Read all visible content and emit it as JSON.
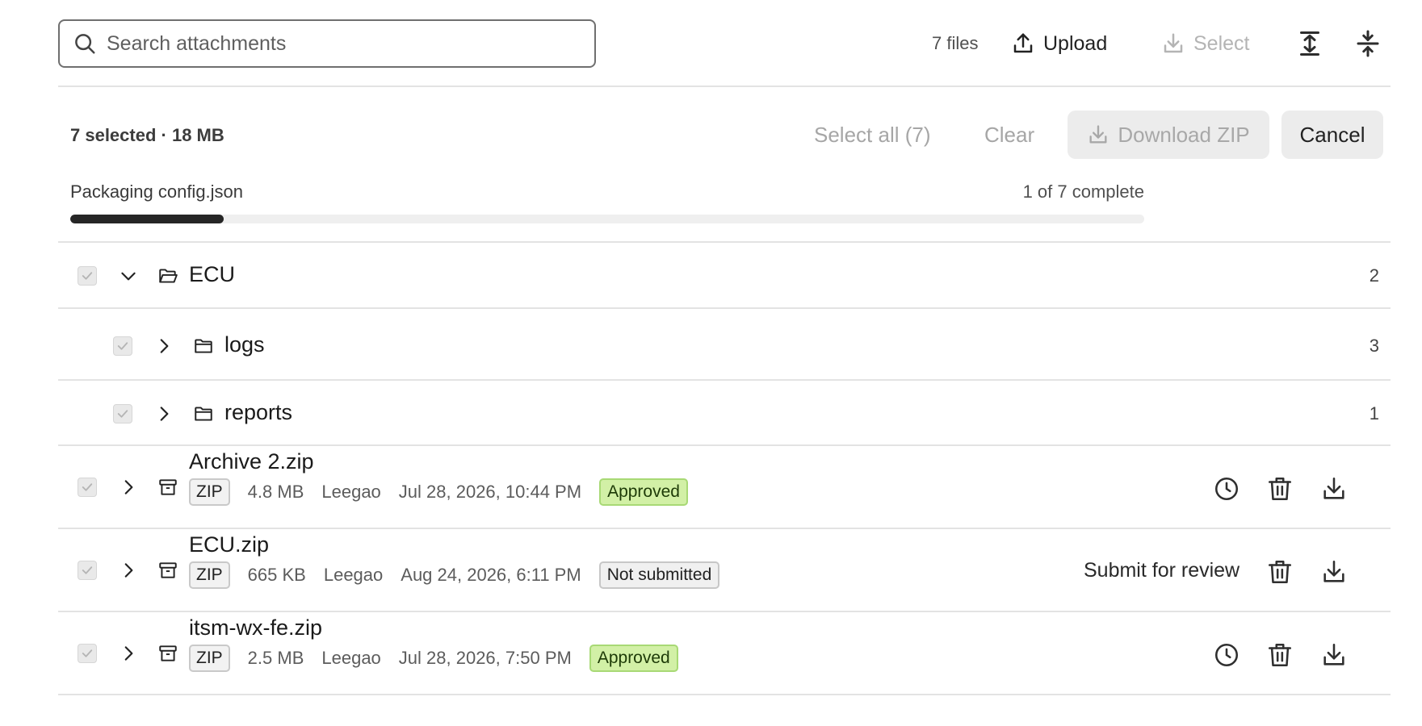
{
  "toolbar": {
    "search_placeholder": "Search attachments",
    "file_count": "7 files",
    "upload_label": "Upload",
    "select_label": "Select"
  },
  "selection": {
    "summary": "7 selected · 18 MB",
    "select_all_label": "Select all (7)",
    "clear_label": "Clear",
    "download_zip_label": "Download ZIP",
    "cancel_label": "Cancel"
  },
  "progress": {
    "label": "Packaging config.json",
    "count_text": "1 of 7 complete",
    "value": 0.143
  },
  "tree": {
    "root": {
      "name": "ECU",
      "count": "2"
    },
    "folders": [
      {
        "name": "logs",
        "count": "3"
      },
      {
        "name": "reports",
        "count": "1"
      }
    ],
    "files": [
      {
        "name": "Archive 2.zip",
        "type": "ZIP",
        "size": "4.8 MB",
        "owner": "Leegao",
        "date": "Jul 28, 2026, 10:44 PM",
        "status": "Approved"
      },
      {
        "name": "ECU.zip",
        "type": "ZIP",
        "size": "665 KB",
        "owner": "Leegao",
        "date": "Aug 24, 2026, 6:11 PM",
        "status": "Not submitted",
        "action_label": "Submit for review"
      },
      {
        "name": "itsm-wx-fe.zip",
        "type": "ZIP",
        "size": "2.5 MB",
        "owner": "Leegao",
        "date": "Jul 28, 2026, 7:50 PM",
        "status": "Approved"
      }
    ]
  },
  "icons": {
    "search": "search-icon",
    "upload": "upload-icon",
    "download": "download-icon",
    "expand_all": "expand-all-icon",
    "collapse_all": "collapse-all-icon",
    "folder_open": "folder-open-icon",
    "folder": "folder-icon",
    "archive": "archive-icon",
    "history": "clock-icon",
    "delete": "trash-icon"
  },
  "colors": {
    "approved_bg": "#d2f0a6",
    "approved_border": "#a8d975",
    "progress_fill": "#262626",
    "disabled_text": "#a8a8a8"
  }
}
